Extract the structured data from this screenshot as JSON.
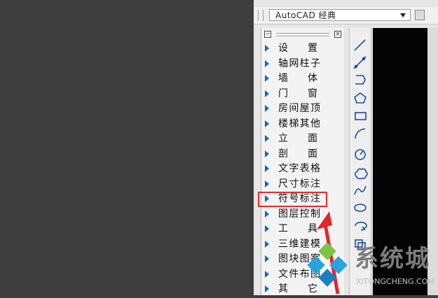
{
  "window": {
    "workspace_combo": {
      "value": "AutoCAD 经典"
    }
  },
  "side_menu": {
    "items": [
      {
        "label": "设置"
      },
      {
        "label": "轴网柱子"
      },
      {
        "label": "墙体"
      },
      {
        "label": "门窗"
      },
      {
        "label": "房间屋顶"
      },
      {
        "label": "楼梯其他"
      },
      {
        "label": "立面"
      },
      {
        "label": "剖面"
      },
      {
        "label": "文字表格"
      },
      {
        "label": "尺寸标注"
      },
      {
        "label": "符号标注"
      },
      {
        "label": "图层控制"
      },
      {
        "label": "工具"
      },
      {
        "label": "三维建模"
      },
      {
        "label": "图块图案"
      },
      {
        "label": "文件布图"
      },
      {
        "label": "其它"
      }
    ],
    "highlighted_item": "符号标注"
  },
  "draw_toolbar": {
    "tools": [
      "line-icon",
      "construction-line-icon",
      "polyline-icon",
      "polygon-icon",
      "rectangle-icon",
      "arc-icon",
      "circle-icon",
      "revision-cloud-icon",
      "spline-icon",
      "ellipse-icon",
      "ellipse-arc-icon",
      "insert-block-icon"
    ]
  },
  "colors": {
    "highlight": "#e13030",
    "menu_triangle": "#1a66b8",
    "canvas": "#050505"
  },
  "watermark": {
    "brand": "系统城",
    "url": "XITONGCHENG.COM"
  }
}
